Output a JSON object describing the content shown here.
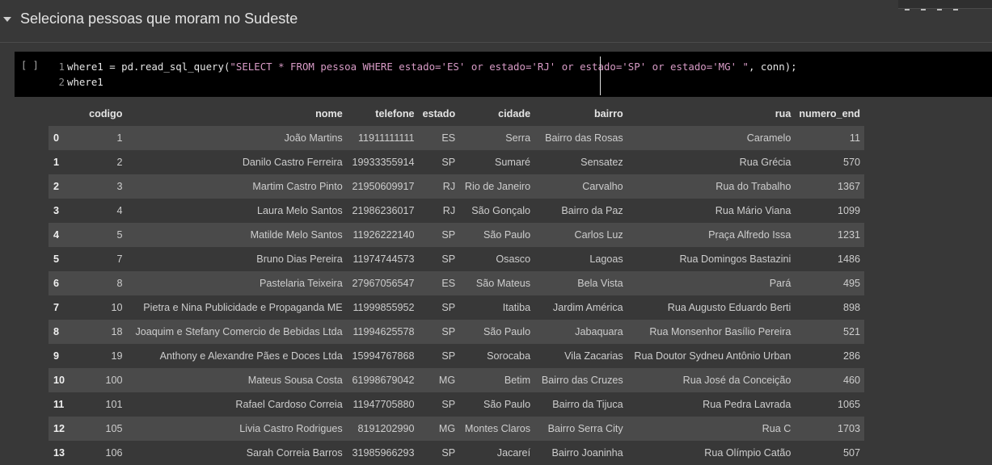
{
  "section": {
    "title": "Seleciona pessoas que moram no Sudeste"
  },
  "code_cell": {
    "run_indicator": "[ ]",
    "lines": [
      {
        "n": "1",
        "pre": "where1 = pd.read_sql_query(",
        "str": "\"SELECT * FROM pessoa WHERE estado='ES' or estado='RJ' or estado='SP' or estado='MG' \"",
        "post": ", conn);"
      },
      {
        "n": "2",
        "pre": "where1",
        "str": "",
        "post": ""
      }
    ]
  },
  "table": {
    "columns": [
      "",
      "codigo",
      "nome",
      "telefone",
      "estado",
      "cidade",
      "bairro",
      "rua",
      "numero_end"
    ],
    "rows": [
      [
        "0",
        "1",
        "João Martins",
        "11911111111",
        "ES",
        "Serra",
        "Bairro das Rosas",
        "Caramelo",
        "11"
      ],
      [
        "1",
        "2",
        "Danilo Castro Ferreira",
        "19933355914",
        "SP",
        "Sumaré",
        "Sensatez",
        "Rua Grécia",
        "570"
      ],
      [
        "2",
        "3",
        "Martim Castro Pinto",
        "21950609917",
        "RJ",
        "Rio de Janeiro",
        "Carvalho",
        "Rua do Trabalho",
        "1367"
      ],
      [
        "3",
        "4",
        "Laura Melo Santos",
        "21986236017",
        "RJ",
        "São Gonçalo",
        "Bairro da Paz",
        "Rua Mário Viana",
        "1099"
      ],
      [
        "4",
        "5",
        "Matilde Melo Santos",
        "11926222140",
        "SP",
        "São Paulo",
        "Carlos Luz",
        "Praça Alfredo Issa",
        "1231"
      ],
      [
        "5",
        "7",
        "Bruno Dias Pereira",
        "11974744573",
        "SP",
        "Osasco",
        "Lagoas",
        "Rua Domingos Bastazini",
        "1486"
      ],
      [
        "6",
        "8",
        "Pastelaria Teixeira",
        "27967056547",
        "ES",
        "São Mateus",
        "Bela Vista",
        "Pará",
        "495"
      ],
      [
        "7",
        "10",
        "Pietra e Nina Publicidade e Propaganda ME",
        "11999855952",
        "SP",
        "Itatiba",
        "Jardim América",
        "Rua Augusto Eduardo Berti",
        "898"
      ],
      [
        "8",
        "18",
        "Joaquim e Stefany Comercio de Bebidas Ltda",
        "11994625578",
        "SP",
        "São Paulo",
        "Jabaquara",
        "Rua Monsenhor Basílio Pereira",
        "521"
      ],
      [
        "9",
        "19",
        "Anthony e Alexandre Pães e Doces Ltda",
        "15994767868",
        "SP",
        "Sorocaba",
        "Vila Zacarias",
        "Rua Doutor Sydneu Antônio Urban",
        "286"
      ],
      [
        "10",
        "100",
        "Mateus Sousa Costa",
        "61998679042",
        "MG",
        "Betim",
        "Bairro das Cruzes",
        "Rua José da Conceição",
        "460"
      ],
      [
        "11",
        "101",
        "Rafael Cardoso Correia",
        "11947705880",
        "SP",
        "São Paulo",
        "Bairro da Tijuca",
        "Rua Pedra Lavrada",
        "1065"
      ],
      [
        "12",
        "105",
        "Livia Castro Rodrigues",
        "8191202990",
        "MG",
        "Montes Claros",
        "Bairro Serra City",
        "Rua C",
        "1703"
      ],
      [
        "13",
        "106",
        "Sarah Correia Barros",
        "31985966293",
        "SP",
        "Jacareí",
        "Bairro Joaninha",
        "Rua Olímpio Catão",
        "507"
      ]
    ]
  }
}
